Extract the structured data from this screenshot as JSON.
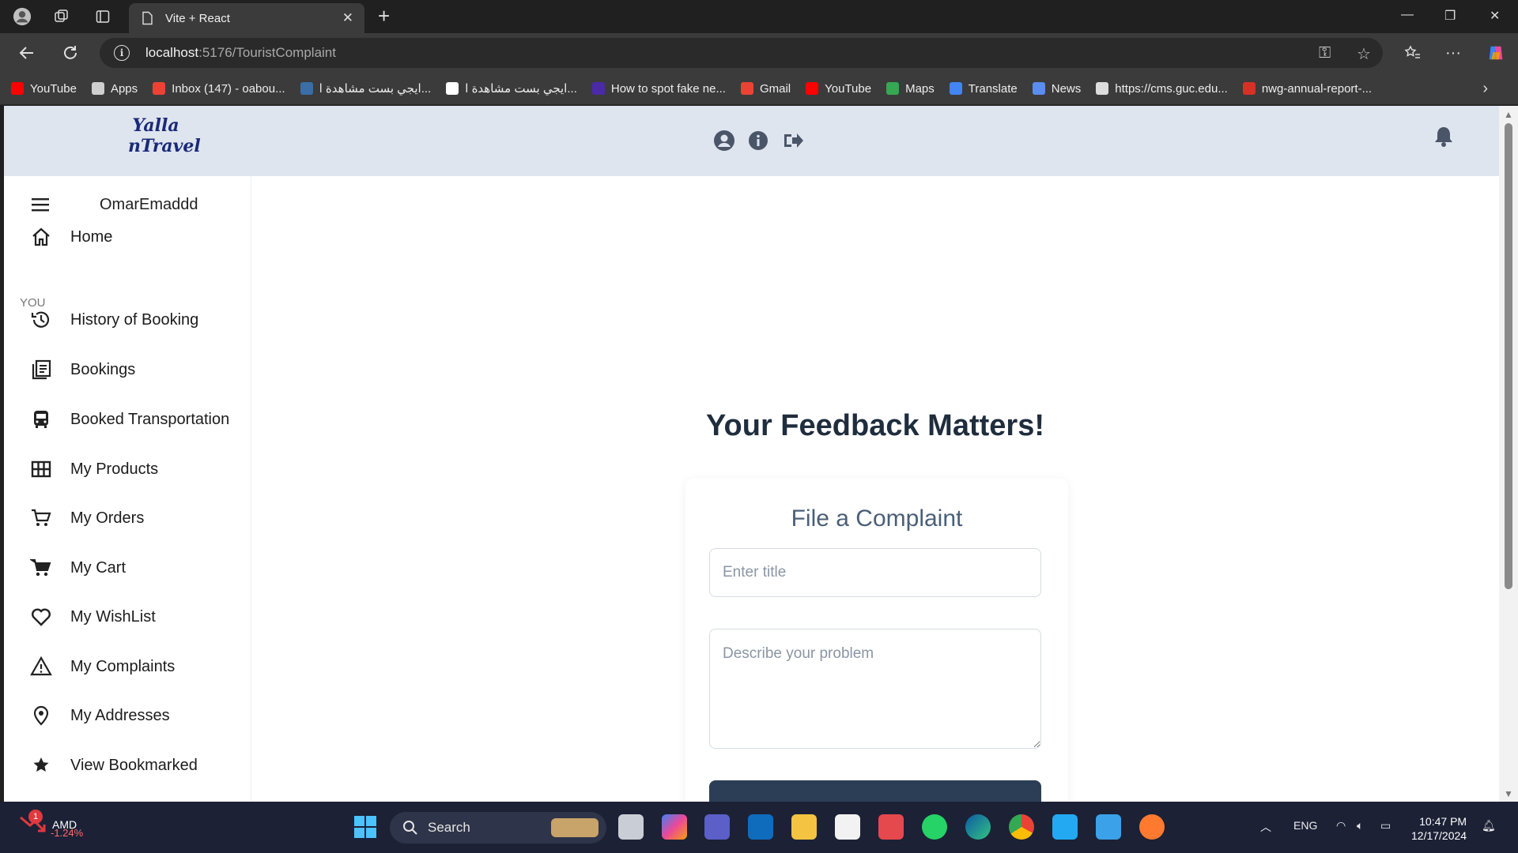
{
  "browser": {
    "tab_title": "Vite + React",
    "url_host": "localhost",
    "url_path": ":5176/TouristComplaint",
    "bookmarks": [
      {
        "label": "YouTube",
        "color": "#ff0000"
      },
      {
        "label": "Apps",
        "color": "#cfcfcf"
      },
      {
        "label": "Inbox (147) - oabou...",
        "color": "#ea4335"
      },
      {
        "label": "ايجي بست مشاهدة ا...",
        "color": "#3a6ea5"
      },
      {
        "label": "ايجي بست مشاهدة ا...",
        "color": "#ffffff"
      },
      {
        "label": "How to spot fake ne...",
        "color": "#4b2aa8"
      },
      {
        "label": "Gmail",
        "color": "#ea4335"
      },
      {
        "label": "YouTube",
        "color": "#ff0000"
      },
      {
        "label": "Maps",
        "color": "#34a853"
      },
      {
        "label": "Translate",
        "color": "#4285f4"
      },
      {
        "label": "News",
        "color": "#5b8def"
      },
      {
        "label": "https://cms.guc.edu...",
        "color": "#dddddd"
      },
      {
        "label": "nwg-annual-report-...",
        "color": "#d93025"
      }
    ]
  },
  "app": {
    "logo_line1": "Yalla",
    "logo_line2": "nTravel",
    "username": "OmarEmaddd",
    "section_you": "YOU",
    "nav": {
      "home": "Home",
      "history": "History of Booking",
      "bookings": "Bookings",
      "transport": "Booked Transportation",
      "products": "My Products",
      "orders": "My Orders",
      "cart": "My Cart",
      "wishlist": "My WishList",
      "complaints": "My Complaints",
      "addresses": "My Addresses",
      "bookmarked": "View Bookmarked"
    },
    "heading": "Your Feedback Matters!",
    "form": {
      "title": "File a Complaint",
      "title_placeholder": "Enter title",
      "desc_placeholder": "Describe your problem",
      "submit_label": ""
    },
    "colors": {
      "header_bg": "#dfe5ef",
      "primary": "#2c3e55"
    }
  },
  "taskbar": {
    "stock_name": "AMD",
    "stock_change": "-1.24%",
    "stock_badge": "1",
    "search_label": "Search",
    "language": "ENG",
    "time": "10:47 PM",
    "date": "12/17/2024"
  }
}
